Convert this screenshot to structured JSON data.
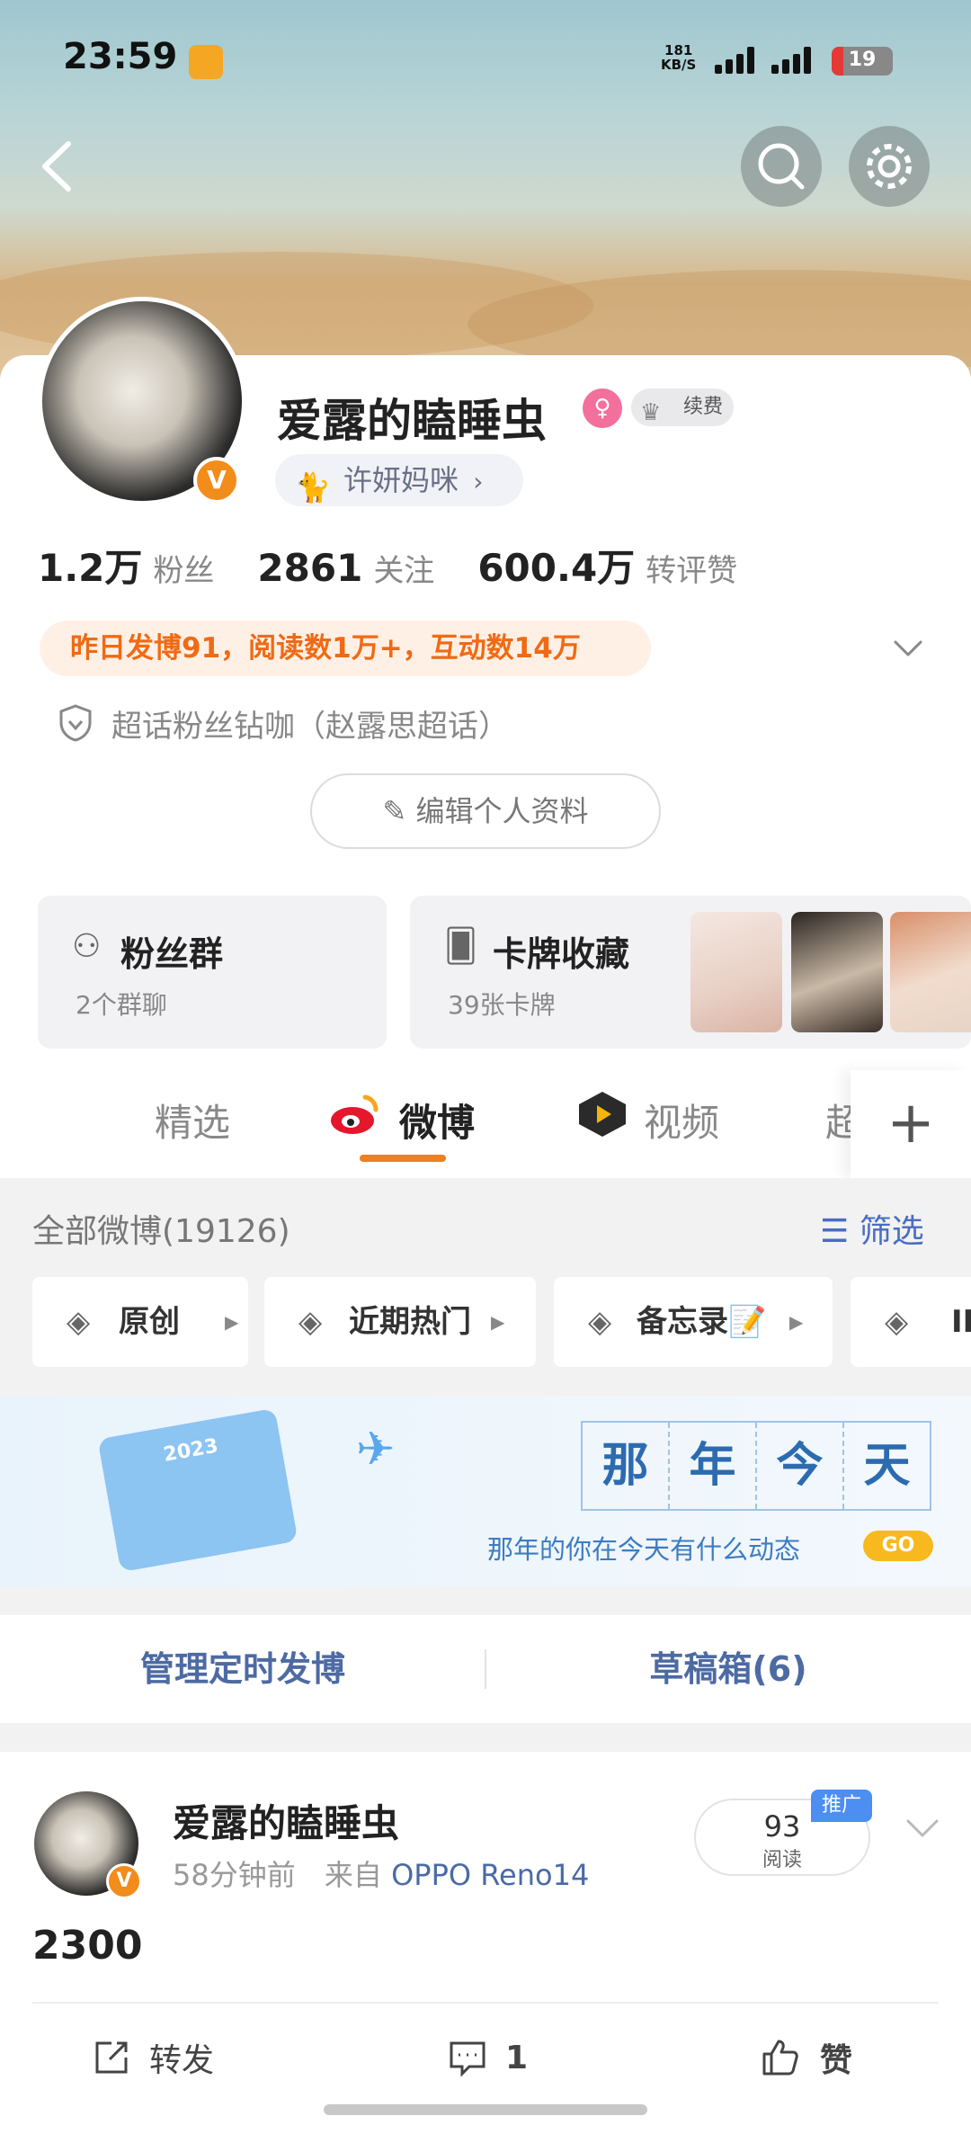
{
  "status_bar": {
    "time": "23:59",
    "network_speed_value": "181",
    "network_speed_unit": "KB/S",
    "battery": "19"
  },
  "profile": {
    "name": "爱露的瞌睡虫",
    "renew_label": "续费",
    "tag_label": "许妍妈咪",
    "stats": [
      {
        "value": "1.2万",
        "label": "粉丝"
      },
      {
        "value": "2861",
        "label": "关注"
      },
      {
        "value": "600.4万",
        "label": "转评赞"
      }
    ],
    "activity_summary": "昨日发博91，阅读数1万+，互动数14万",
    "super_topic": "超话粉丝钻咖（赵露思超话）",
    "edit_button": "编辑个人资料"
  },
  "boxes": {
    "fan_group": {
      "title": "粉丝群",
      "subtitle": "2个群聊"
    },
    "card_collection": {
      "title": "卡牌收藏",
      "subtitle": "39张卡牌"
    }
  },
  "tabs": [
    {
      "label": "精选"
    },
    {
      "label": "微博"
    },
    {
      "label": "视频"
    },
    {
      "label": "超"
    }
  ],
  "feed": {
    "all_posts_title": "全部微博(19126)",
    "filter_label": "筛选",
    "chips": [
      "原创",
      "近期热门",
      "备忘录📝",
      "ID"
    ],
    "promo": {
      "calendar_year": "2023",
      "headline_chars": [
        "那",
        "年",
        "今",
        "天"
      ],
      "subtitle": "那年的你在今天有什么动态",
      "go": "GO"
    },
    "actions": {
      "scheduled": "管理定时发博",
      "drafts": "草稿箱(6)"
    }
  },
  "post": {
    "author": "爱露的瞌睡虫",
    "time_ago": "58分钟前",
    "from_label": "来自",
    "device": "OPPO Reno14",
    "reads_count": "93",
    "reads_label": "阅读",
    "promote_tag": "推广",
    "content": "2300",
    "repost_label": "转发",
    "comment_count": "1",
    "like_label": "赞"
  }
}
